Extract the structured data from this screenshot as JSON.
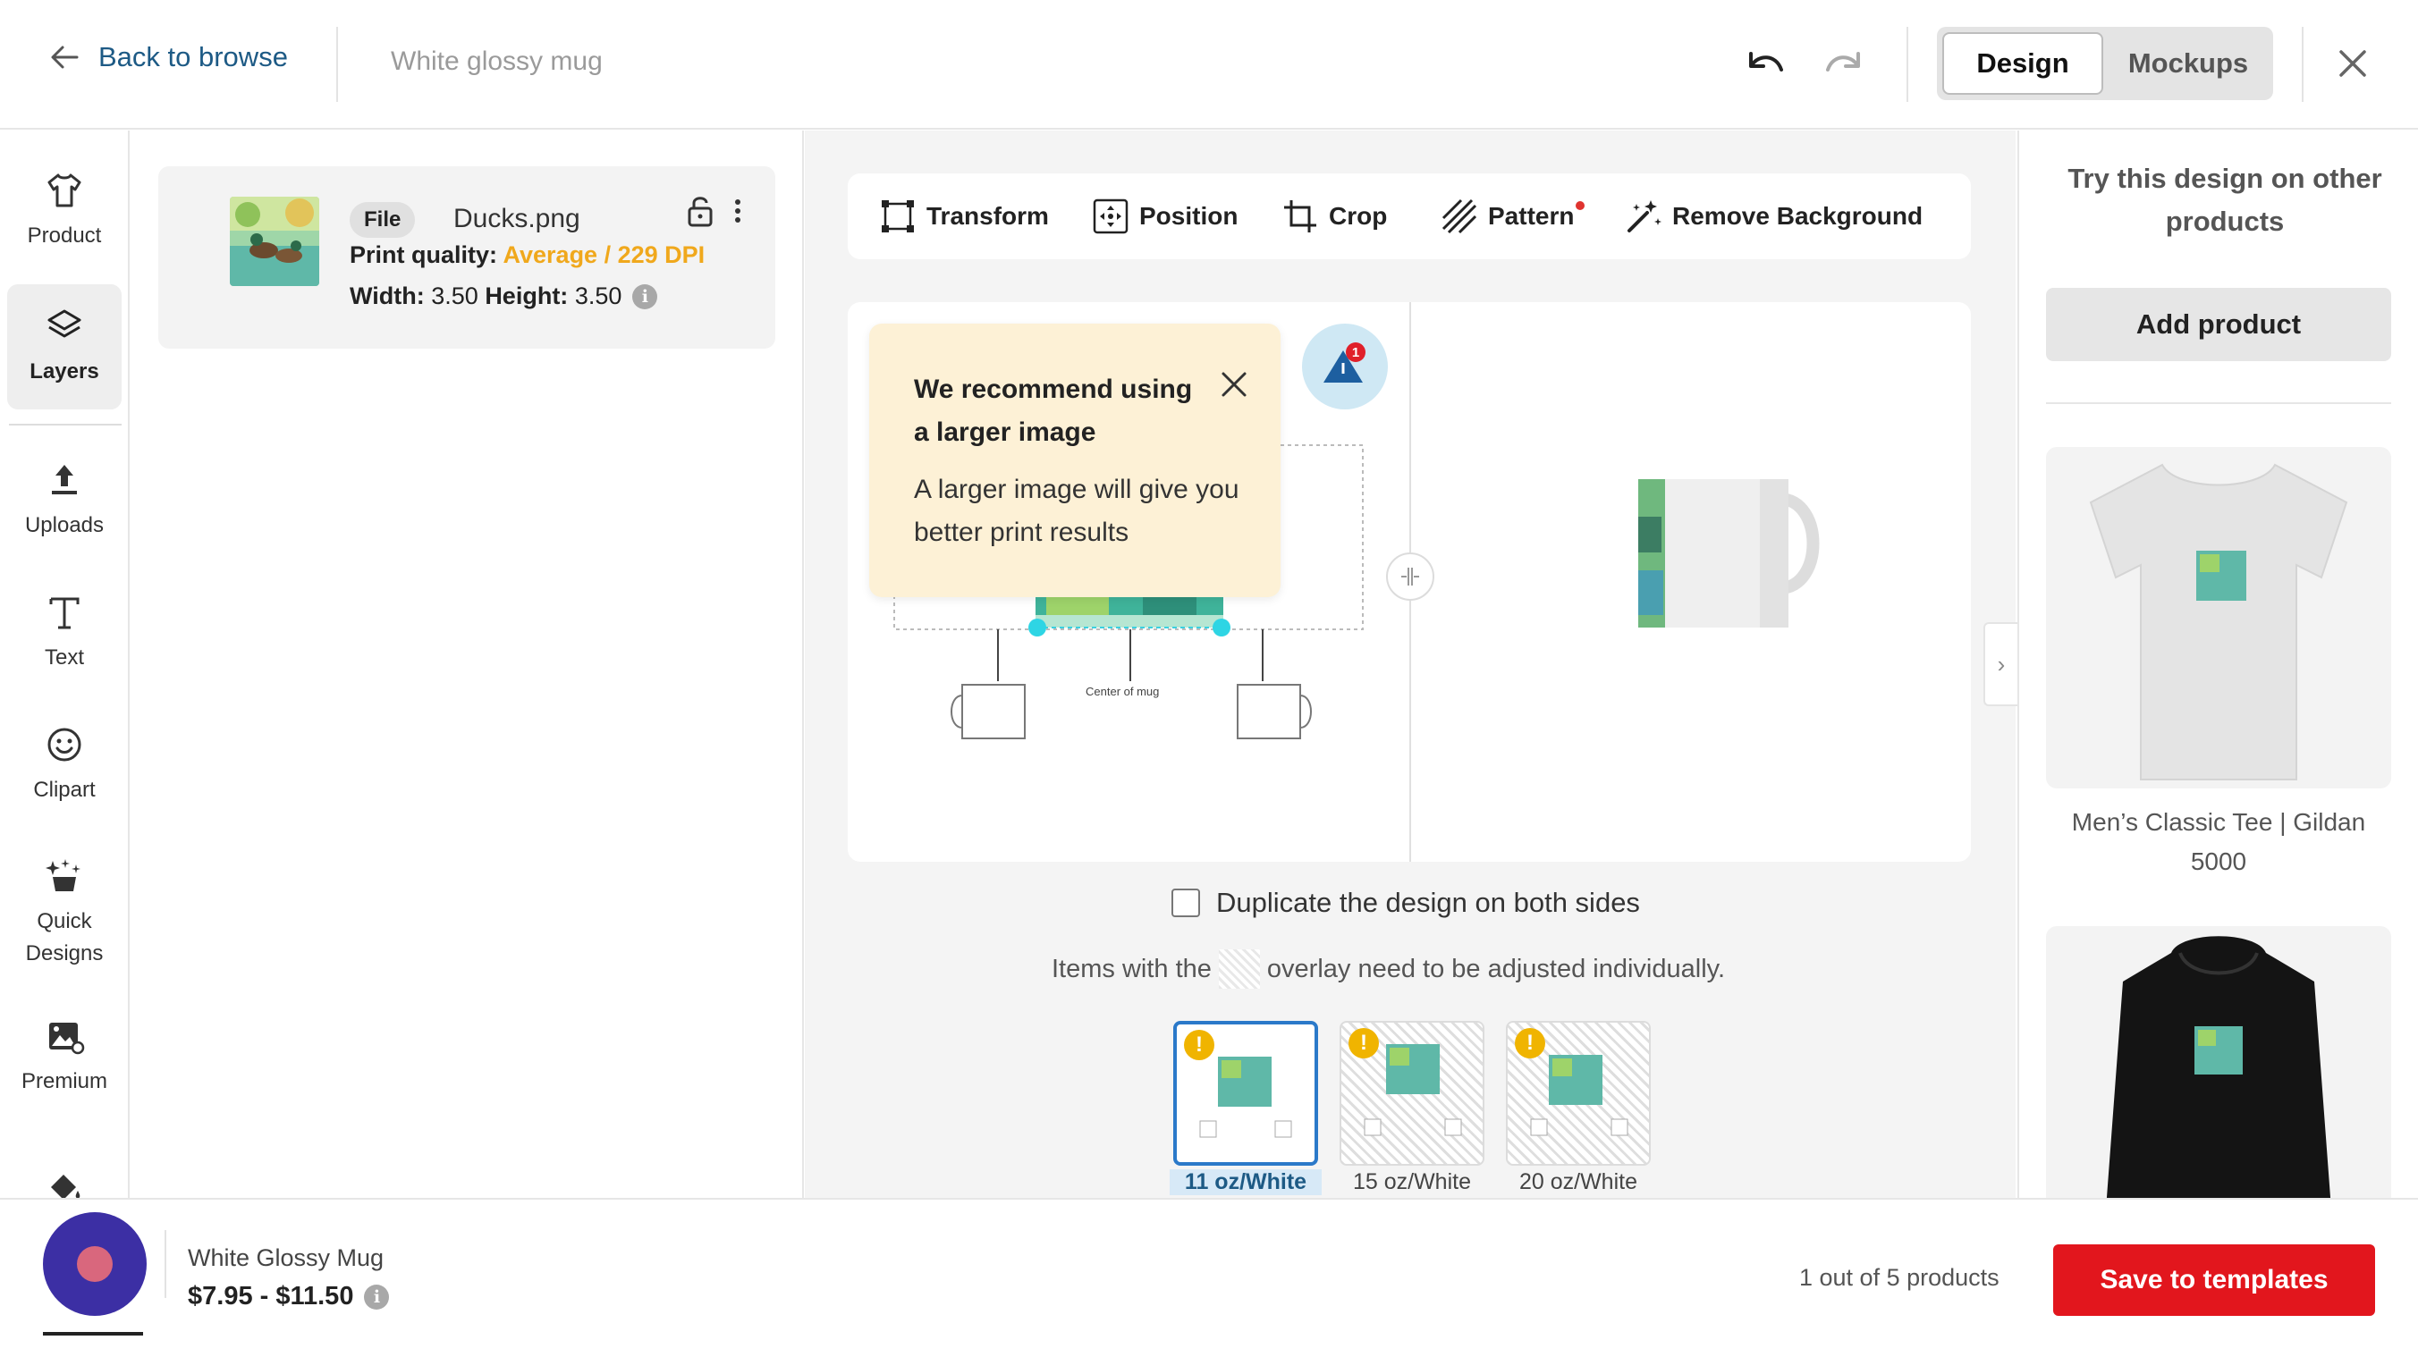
{
  "header": {
    "back_label": "Back to browse",
    "product_title": "White glossy mug",
    "tabs": [
      "Design",
      "Mockups"
    ],
    "active_tab": "Design"
  },
  "sidebar": {
    "items": [
      {
        "label": "Product",
        "icon": "shirt-icon"
      },
      {
        "label": "Layers",
        "icon": "layers-icon",
        "active": true
      },
      {
        "label": "Uploads",
        "icon": "upload-icon"
      },
      {
        "label": "Text",
        "icon": "text-icon"
      },
      {
        "label": "Clipart",
        "icon": "smiley-icon"
      },
      {
        "label": "Quick Designs",
        "icon": "sparkle-icon"
      },
      {
        "label": "Premium",
        "icon": "premium-image-icon"
      },
      {
        "label": "",
        "icon": "paint-bucket-icon"
      }
    ]
  },
  "layer": {
    "type_badge": "File",
    "file_name": "Ducks.png",
    "print_quality_label": "Print quality:",
    "print_quality_value": "Average / 229 DPI",
    "width_label": "Width:",
    "width_value": "3.50",
    "height_label": "Height:",
    "height_value": "3.50"
  },
  "toolbar": {
    "tools": [
      "Transform",
      "Position",
      "Crop",
      "Pattern",
      "Remove Background"
    ]
  },
  "canvas": {
    "tooltip_title": "We recommend using a larger image",
    "tooltip_body": "A larger image will give you better print results",
    "warning_count": "1",
    "center_label": "Center of mug"
  },
  "options": {
    "duplicate_label": "Duplicate the design on both sides",
    "overlay_note_before": "Items with the",
    "overlay_note_after": "overlay need to be adjusted individually."
  },
  "variants": [
    {
      "label": "11 oz/White",
      "selected": true
    },
    {
      "label": "15 oz/White",
      "selected": false
    },
    {
      "label": "20 oz/White",
      "selected": false
    }
  ],
  "right_panel": {
    "title": "Try this design on other products",
    "add_product_label": "Add product",
    "products": [
      {
        "name": "Men’s Classic Tee | Gildan 5000"
      }
    ]
  },
  "footer": {
    "product_name": "White Glossy Mug",
    "price": "$7.95 - $11.50",
    "count_text": "1 out of 5 products",
    "save_label": "Save to templates"
  },
  "colors": {
    "accent_blue": "#1d5a85",
    "quality_warning": "#f0a81c",
    "save_red": "#e2161d",
    "fab_purple": "#3c2fa4"
  }
}
